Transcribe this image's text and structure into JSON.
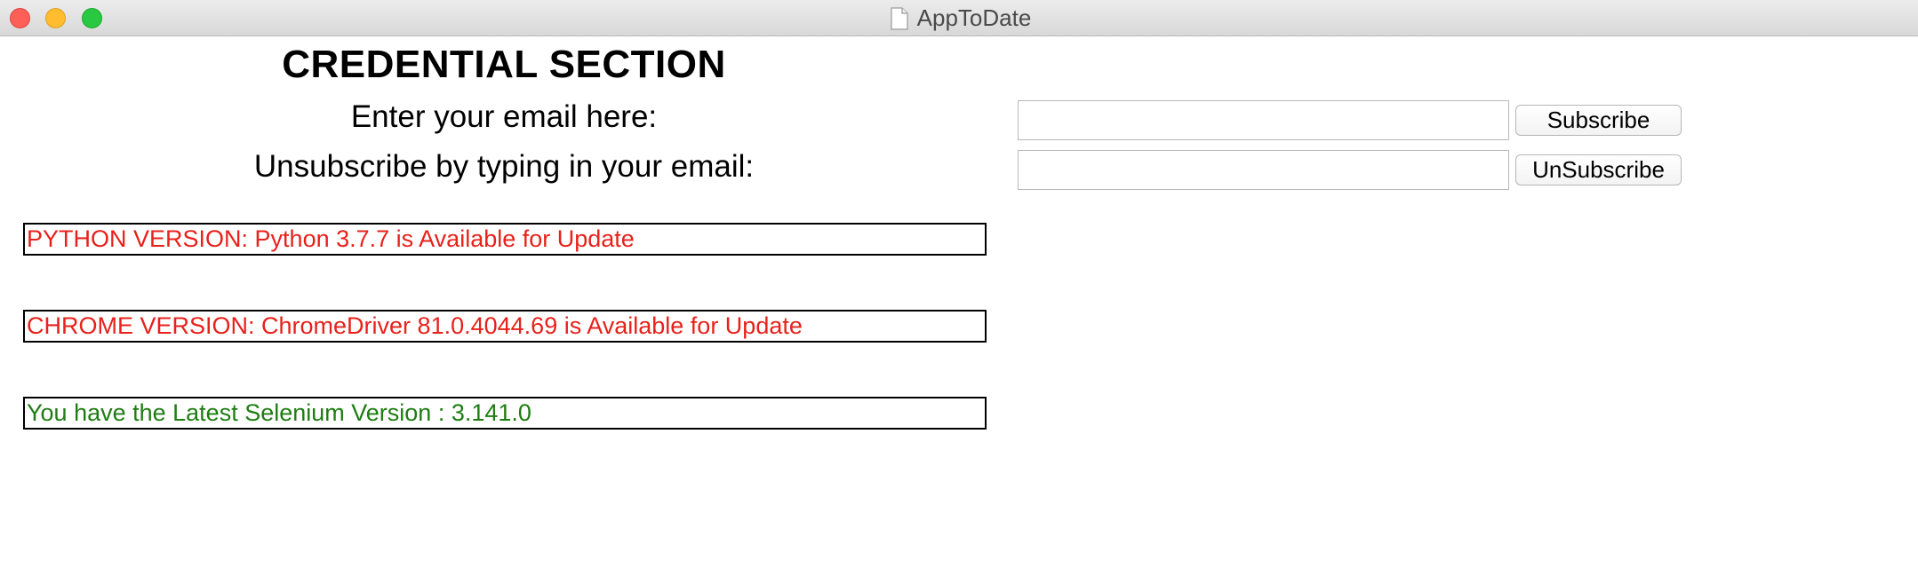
{
  "window": {
    "title": "AppToDate"
  },
  "credential": {
    "heading": "CREDENTIAL SECTION",
    "subscribe_label": "Enter your email here:",
    "subscribe_input_value": "",
    "subscribe_button": "Subscribe",
    "unsubscribe_label": "Unsubscribe by typing in your email:",
    "unsubscribe_input_value": "",
    "unsubscribe_button": "UnSubscribe"
  },
  "status": {
    "python": "PYTHON VERSION: Python 3.7.7 is Available for Update",
    "chrome": "CHROME VERSION: ChromeDriver 81.0.4044.69 is Available for Update",
    "selenium": "You have the Latest Selenium Version : 3.141.0"
  },
  "colors": {
    "update_available": "#e8211b",
    "up_to_date": "#1e7d12"
  },
  "icons": {
    "title_icon": "document-icon"
  }
}
